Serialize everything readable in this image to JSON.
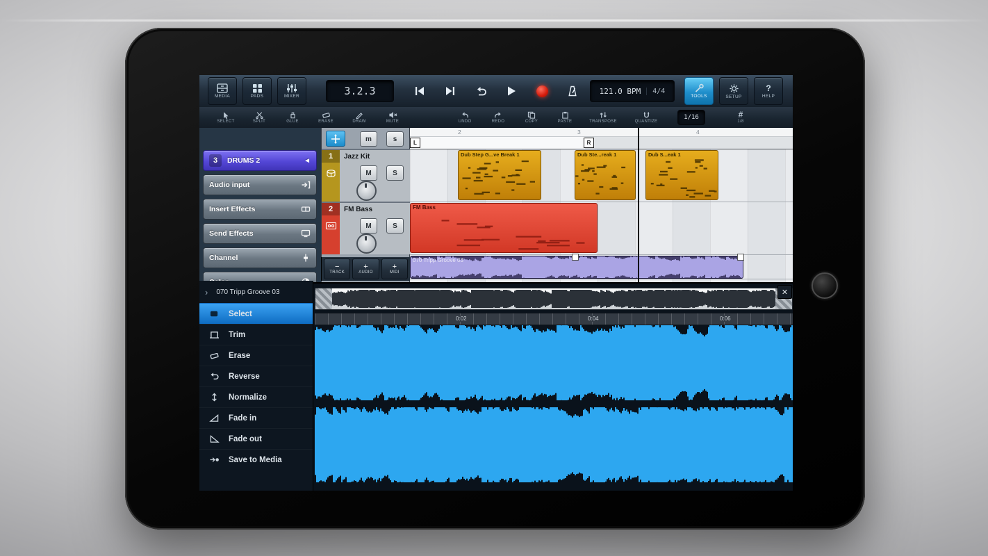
{
  "colors": {
    "accent_blue": "#2d9fe8",
    "selection_blue": "#1787e0",
    "track1_color": "#b5961e",
    "track2_color": "#d6402e",
    "clip_orange": "#d79210",
    "clip_red": "#e1493a",
    "clip_audio_purple": "#453f6c",
    "waveform_blue": "#2da7f0"
  },
  "transport": {
    "left_buttons": [
      "MEDIA",
      "PADS",
      "MIXER"
    ],
    "time_display": "3.2.3",
    "bpm_display": "121.0 BPM",
    "time_signature": "4/4",
    "tools_label": "TOOLS",
    "setup_label": "SETUP",
    "help_label": "HELP",
    "help_glyph": "?"
  },
  "edit_bar": {
    "tools": [
      "SELECT",
      "SPLIT",
      "GLUE",
      "ERASE",
      "DRAW",
      "MUTE"
    ],
    "actions": [
      "UNDO",
      "REDO",
      "COPY",
      "PASTE",
      "TRANSPOSE",
      "QUANTIZE"
    ],
    "grid_value": "1/16",
    "grid_glyph": "#",
    "grid_sub": "1/8"
  },
  "inspector": {
    "track_select": {
      "number": "3",
      "label": "DRUMS 2",
      "arrow": "◄"
    },
    "items": [
      "Audio input",
      "Insert Effects",
      "Send Effects",
      "Channel",
      "Color"
    ]
  },
  "global_row": {
    "mute": "m",
    "solo": "s"
  },
  "tracks": [
    {
      "number": "1",
      "name": "Jazz Kit",
      "mute": "M",
      "solo": "S"
    },
    {
      "number": "2",
      "name": "FM Bass",
      "mute": "M",
      "solo": "S"
    }
  ],
  "ruler": {
    "numbers": [
      "2",
      "3",
      "4"
    ],
    "left_locator": "L",
    "right_locator": "R"
  },
  "clips": {
    "midi": [
      "Dub Step G...ve Break 1",
      "Dub Ste...reak 1",
      "Dub S...eak 1"
    ],
    "bass_label": "FM Bass",
    "audio_label": "070 Tripp Groove 03"
  },
  "add_buttons": [
    {
      "sign": "−",
      "label": "TRACK"
    },
    {
      "sign": "+",
      "label": "AUDIO"
    },
    {
      "sign": "+",
      "label": "MIDI"
    }
  ],
  "editor": {
    "time_labels": [
      "0:02",
      "0:04",
      "0:06"
    ],
    "close_glyph": "✕"
  },
  "tool_menu": {
    "chevron": "›",
    "title": "070 Tripp Groove 03",
    "items": [
      "Select",
      "Trim",
      "Erase",
      "Reverse",
      "Normalize",
      "Fade in",
      "Fade out",
      "Save to Media"
    ]
  }
}
